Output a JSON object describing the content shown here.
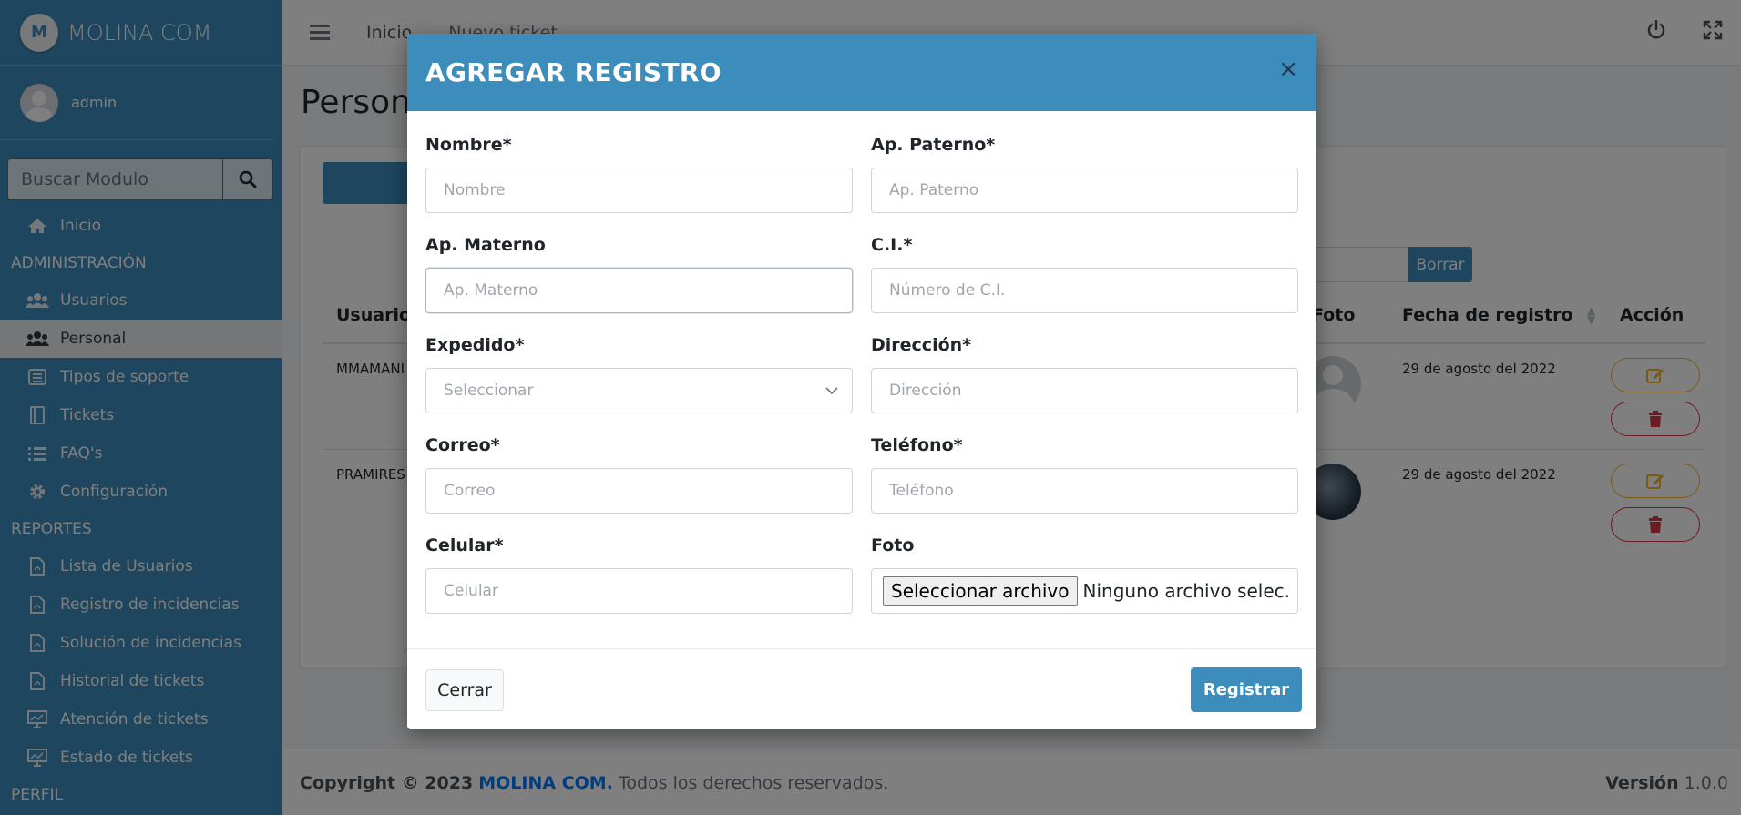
{
  "brand": {
    "name": "MOLINA COM",
    "logo_letter": "M"
  },
  "user": {
    "name": "admin"
  },
  "sidebar": {
    "search_placeholder": "Buscar Modulo",
    "items": [
      {
        "label": "Inicio",
        "icon": "home-icon"
      },
      {
        "header": "ADMINISTRACIÓN"
      },
      {
        "label": "Usuarios",
        "icon": "users-icon"
      },
      {
        "label": "Personal",
        "icon": "users-icon",
        "active": true
      },
      {
        "label": "Tipos de soporte",
        "icon": "list-alt-icon"
      },
      {
        "label": "Tickets",
        "icon": "book-icon"
      },
      {
        "label": "FAQ's",
        "icon": "list-icon"
      },
      {
        "label": "Configuración",
        "icon": "gear-icon"
      },
      {
        "header": "REPORTES"
      },
      {
        "label": "Lista de Usuarios",
        "icon": "pdf-icon"
      },
      {
        "label": "Registro de incidencias",
        "icon": "pdf-icon"
      },
      {
        "label": "Solución de incidencias",
        "icon": "pdf-icon"
      },
      {
        "label": "Historial de tickets",
        "icon": "pdf-icon"
      },
      {
        "label": "Atención de tickets",
        "icon": "chart-icon"
      },
      {
        "label": "Estado de tickets",
        "icon": "chart-icon"
      },
      {
        "header": "PERFIL"
      }
    ]
  },
  "topbar": {
    "links": [
      "Inicio",
      "Nuevo ticket"
    ],
    "icons": [
      "power-icon",
      "expand-icon"
    ]
  },
  "page": {
    "title": "Personal"
  },
  "table": {
    "filter_button": "Borrar",
    "headers": [
      "Usuario",
      "Foto",
      "Fecha de registro",
      "Acción"
    ],
    "rows": [
      {
        "usuario": "MMAMANI",
        "fecha": "29 de agosto del 2022"
      },
      {
        "usuario": "PRAMIRES",
        "fecha": "29 de agosto del 2022"
      }
    ]
  },
  "footer": {
    "copyright": "Copyright © 2023",
    "brand": "MOLINA COM.",
    "rights": "Todos los derechos reservados.",
    "version_label": "Versión",
    "version": "1.0.0"
  },
  "modal": {
    "title": "AGREGAR REGISTRO",
    "close": "×",
    "fields": {
      "nombre": {
        "label": "Nombre*",
        "placeholder": "Nombre"
      },
      "paterno": {
        "label": "Ap. Paterno*",
        "placeholder": "Ap. Paterno"
      },
      "materno": {
        "label": "Ap. Materno",
        "placeholder": "Ap. Materno"
      },
      "ci": {
        "label": "C.I.*",
        "placeholder": "Número de C.I."
      },
      "expedido": {
        "label": "Expedido*",
        "placeholder": "Seleccionar"
      },
      "direccion": {
        "label": "Dirección*",
        "placeholder": "Dirección"
      },
      "correo": {
        "label": "Correo*",
        "placeholder": "Correo"
      },
      "telefono": {
        "label": "Teléfono*",
        "placeholder": "Teléfono"
      },
      "celular": {
        "label": "Celular*",
        "placeholder": "Celular"
      },
      "foto": {
        "label": "Foto",
        "button": "Seleccionar archivo",
        "status": "Ninguno archivo selec."
      }
    },
    "buttons": {
      "close": "Cerrar",
      "submit": "Registrar"
    }
  },
  "colors": {
    "primary": "#3c8dbc",
    "warning": "#f0b429",
    "danger": "#dc3545",
    "link": "#007bff"
  }
}
